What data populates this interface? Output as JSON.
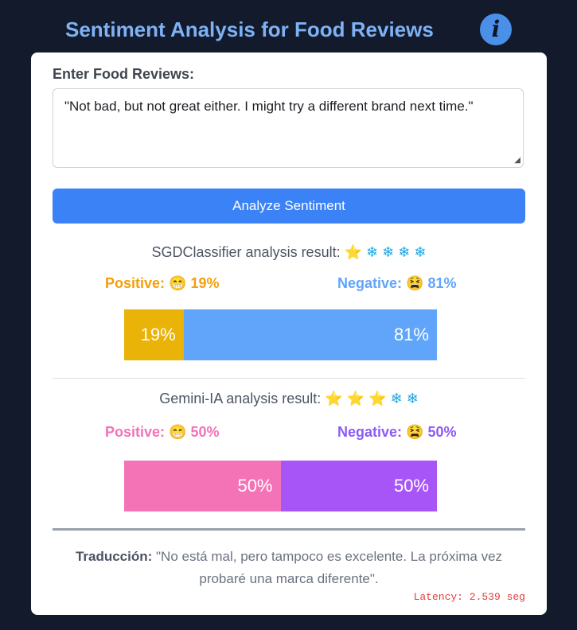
{
  "header": {
    "title": "Sentiment Analysis for Food Reviews",
    "info_icon": "i"
  },
  "form": {
    "label": "Enter Food Reviews:",
    "review_text": "\"Not bad, but not great either. I might try a different brand next time.\"",
    "button_label": "Analyze Sentiment"
  },
  "results": [
    {
      "title": "SGDClassifier analysis result:",
      "rating_icons": [
        "⭐",
        "❄",
        "❄",
        "❄",
        "❄"
      ],
      "positive_label": "Positive:",
      "positive_emoji": "😁",
      "positive_pct": "19%",
      "positive_value": 19,
      "negative_label": "Negative:",
      "negative_emoji": "😫",
      "negative_pct": "81%",
      "negative_value": 81,
      "colors": {
        "positive_text": "#f59e0b",
        "negative_text": "#60a5fa",
        "positive_bar": "#eab308",
        "negative_bar": "#60a5fa"
      }
    },
    {
      "title": "Gemini-IA analysis result:",
      "rating_icons": [
        "⭐",
        "⭐",
        "⭐",
        "❄",
        "❄"
      ],
      "positive_label": "Positive:",
      "positive_emoji": "😁",
      "positive_pct": "50%",
      "positive_value": 50,
      "negative_label": "Negative:",
      "negative_emoji": "😫",
      "negative_pct": "50%",
      "negative_value": 50,
      "colors": {
        "positive_text": "#f472b6",
        "negative_text": "#8b5cf6",
        "positive_bar": "#f472b6",
        "negative_bar": "#a855f7"
      }
    }
  ],
  "translation": {
    "label": "Traducción:",
    "text": " \"No está mal, pero tampoco es excelente. La próxima vez probaré una marca diferente\"."
  },
  "latency": "Latency: 2.539 seg"
}
